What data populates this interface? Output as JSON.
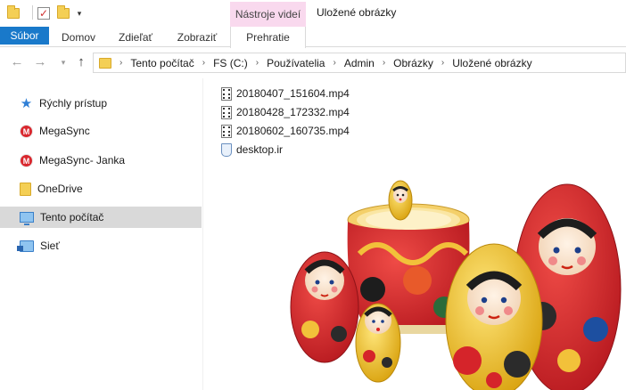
{
  "window": {
    "title": "Uložené obrázky",
    "context_tab": "Nástroje videí"
  },
  "ribbon": {
    "tabs": [
      {
        "label": "Súbor"
      },
      {
        "label": "Domov"
      },
      {
        "label": "Zdieľať"
      },
      {
        "label": "Zobraziť"
      },
      {
        "label": "Prehratie"
      }
    ]
  },
  "address": {
    "crumbs": [
      "Tento počítač",
      "FS (C:)",
      "Používatelia",
      "Admin",
      "Obrázky",
      "Uložené obrázky"
    ]
  },
  "nav": {
    "items": [
      {
        "label": "Rýchly prístup",
        "icon": "quick-access-star-icon"
      },
      {
        "label": "MegaSync",
        "icon": "megasync-icon"
      },
      {
        "label": "MegaSync- Janka",
        "icon": "megasync-icon"
      },
      {
        "label": "OneDrive",
        "icon": "onedrive-folder-icon"
      },
      {
        "label": "Tento počítač",
        "icon": "computer-icon",
        "selected": true
      },
      {
        "label": "Sieť",
        "icon": "network-icon"
      }
    ]
  },
  "files": [
    {
      "name": "20180407_151604.mp4",
      "icon": "video-file-icon"
    },
    {
      "name": "20180428_172332.mp4",
      "icon": "video-file-icon"
    },
    {
      "name": "20180602_160735.mp4",
      "icon": "video-file-icon"
    },
    {
      "name": "desktop.ir",
      "icon": "ini-file-icon"
    }
  ],
  "colors": {
    "file_tab": "#1979ca",
    "context_tab": "#f9d9ee",
    "selection": "#d9d9d9",
    "doll_red": "#d5242a",
    "doll_yellow": "#f0c419"
  }
}
